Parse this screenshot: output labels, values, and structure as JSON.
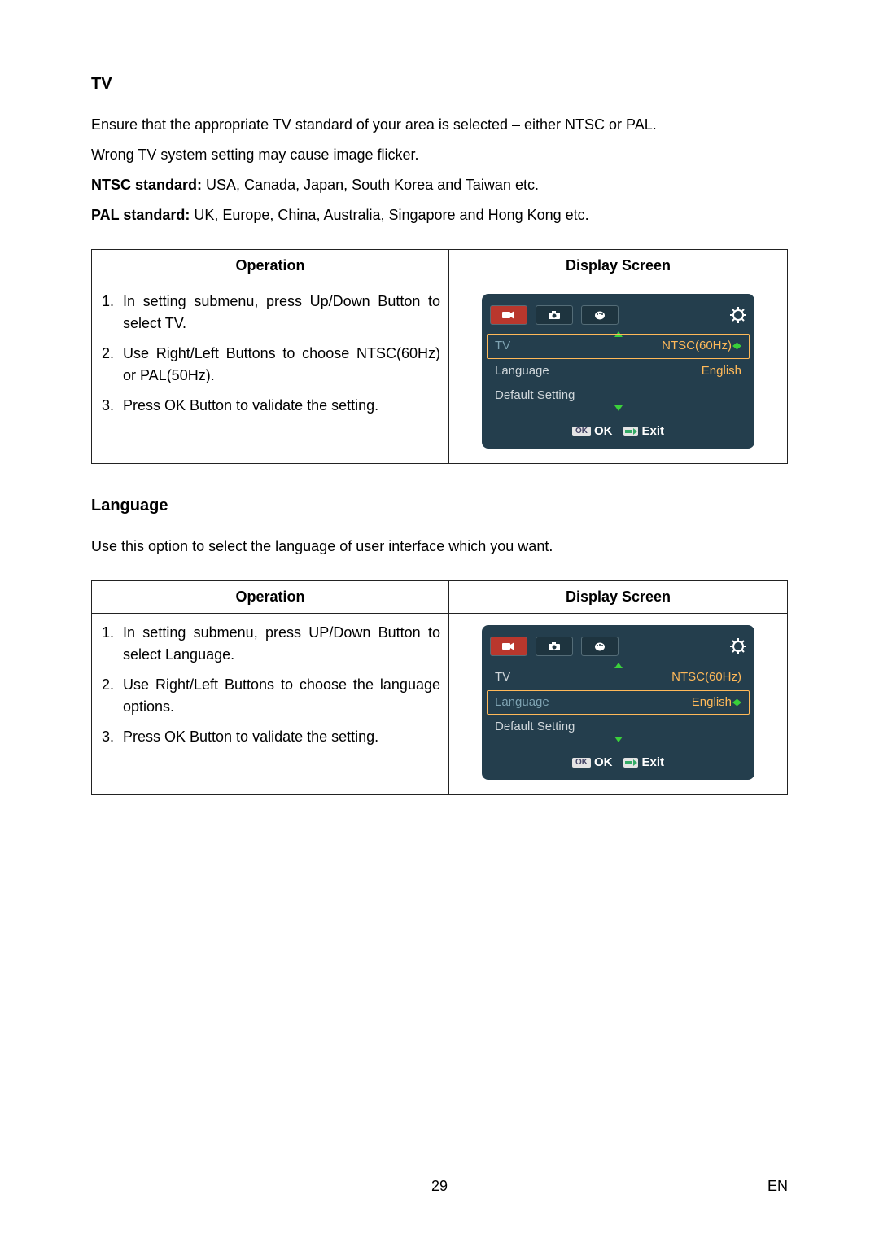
{
  "sections": {
    "tv": {
      "title": "TV",
      "paras": [
        "Ensure that the appropriate TV standard of your area is selected – either NTSC or PAL.",
        "Wrong TV system setting may cause image flicker."
      ],
      "kv": [
        {
          "strong": "NTSC standard:",
          "rest": " USA, Canada, Japan, South Korea and Taiwan etc."
        },
        {
          "strong": "PAL standard:",
          "rest": " UK, Europe, China, Australia, Singapore and Hong Kong etc."
        }
      ],
      "table": {
        "headers": {
          "op": "Operation",
          "screen": "Display Screen"
        },
        "steps": [
          "In setting submenu, press Up/Down Button to select TV.",
          "Use Right/Left Buttons to choose NTSC(60Hz) or PAL(50Hz).",
          "Press OK Button to validate the setting."
        ],
        "screen": {
          "active_row": "tv",
          "rows": {
            "tv": {
              "label": "TV",
              "value": "NTSC(60Hz)",
              "arrows": true
            },
            "lang": {
              "label": "Language",
              "value": "English",
              "arrows": false
            },
            "def": {
              "label": "Default Setting",
              "value": "",
              "arrows": false
            }
          },
          "foot": {
            "ok": "OK",
            "exit": "Exit"
          }
        }
      }
    },
    "language": {
      "title": "Language",
      "paras": [
        "Use this option to select the language of user interface which you want."
      ],
      "table": {
        "headers": {
          "op": "Operation",
          "screen": "Display Screen"
        },
        "steps": [
          "In setting submenu, press UP/Down Button to select Language.",
          "Use Right/Left Buttons to choose the language options.",
          "Press OK Button to validate the setting."
        ],
        "screen": {
          "active_row": "lang",
          "rows": {
            "tv": {
              "label": "TV",
              "value": "NTSC(60Hz)",
              "arrows": false
            },
            "lang": {
              "label": "Language",
              "value": "English",
              "arrows": true
            },
            "def": {
              "label": "Default Setting",
              "value": "",
              "arrows": false
            }
          },
          "foot": {
            "ok": "OK",
            "exit": "Exit"
          }
        }
      }
    }
  },
  "icons": {
    "video": "video-icon",
    "camera": "camera-icon",
    "palette": "palette-icon",
    "gear": "gear-icon"
  },
  "footer": {
    "page": "29",
    "lang": "EN"
  }
}
